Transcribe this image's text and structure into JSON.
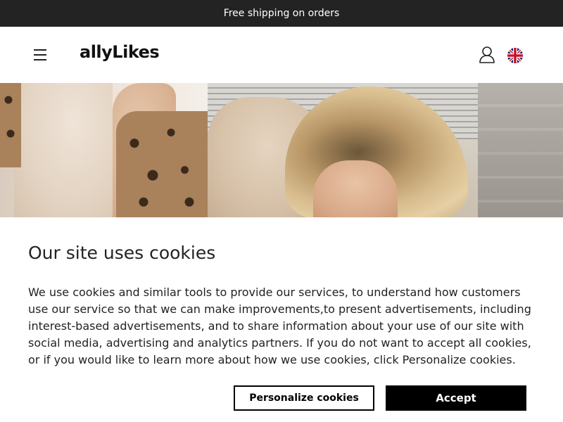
{
  "announcement": {
    "text": "Free shipping on orders"
  },
  "header": {
    "logo": "allyLikes",
    "menu_icon": "hamburger-menu-icon",
    "account_icon": "user-account-icon",
    "language_icon": "uk-flag-icon"
  },
  "hero": {
    "images": [
      {
        "name": "model-leopard-jacket-photo"
      },
      {
        "name": "model-teddy-jacket-photo"
      },
      {
        "name": "model-partial-photo"
      }
    ]
  },
  "cookie_banner": {
    "title": "Our site uses cookies",
    "body": "We use cookies and similar tools to provide our services, to understand how customers use our service so that we can make improvements,to present advertisements, including interest-based advertisements, and to share information about your use of our site with social media, advertising and analytics partners. If you do not want to accept all cookies, or if you would like to learn more about how we use cookies, click Personalize cookies.",
    "personalize_label": "Personalize cookies",
    "accept_label": "Accept"
  },
  "colors": {
    "announcement_bg": "#232323",
    "accept_bg": "#000000",
    "text": "#222222"
  }
}
